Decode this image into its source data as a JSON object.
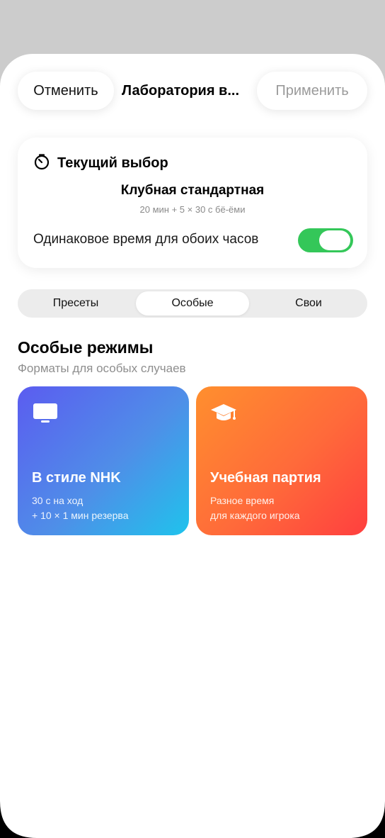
{
  "header": {
    "cancel_label": "Отменить",
    "title": "Лаборатория в...",
    "apply_label": "Применить"
  },
  "current": {
    "heading": "Текущий выбор",
    "name": "Клубная стандартная",
    "details": "20 мин + 5 × 30 с бё-ёми",
    "same_time_label": "Одинаковое время для обоих часов",
    "same_time_on": true
  },
  "tabs": [
    {
      "label": "Пресеты",
      "selected": false
    },
    {
      "label": "Особые",
      "selected": true
    },
    {
      "label": "Свои",
      "selected": false
    }
  ],
  "section": {
    "title": "Особые режимы",
    "subtitle": "Форматы для особых случаев"
  },
  "modes": [
    {
      "icon": "tv-icon",
      "title": "В стиле NHK",
      "line1": "30 с на ход",
      "line2": "+ 10 × 1 мин резерва"
    },
    {
      "icon": "graduation-cap-icon",
      "title": "Учебная партия",
      "line1": "Разное время",
      "line2": "для каждого игрока"
    }
  ],
  "colors": {
    "toggle_on": "#34c759",
    "apply_disabled": "#9a9a9a",
    "nhk_gradient": [
      "#5b5cf0",
      "#1fc3ec"
    ],
    "study_gradient": [
      "#ff8f2e",
      "#ff3f3f"
    ]
  }
}
